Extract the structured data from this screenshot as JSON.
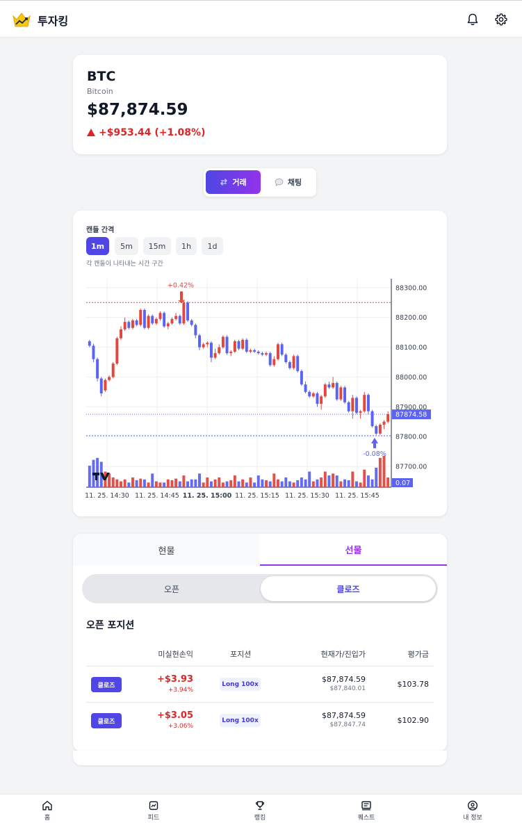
{
  "app": {
    "title": "투자킹"
  },
  "icons": {
    "logo": "crown-chart-icon",
    "notifications": "bell-icon",
    "settings": "gear-icon"
  },
  "ticker": {
    "symbol": "BTC",
    "name": "Bitcoin",
    "price": "$87,874.59",
    "change": "+$953.44 (+1.08%)",
    "direction": "up"
  },
  "mode_tabs": [
    {
      "label": "거래",
      "icon": "exchange-icon",
      "active": true
    },
    {
      "label": "채팅",
      "icon": "chat-bubble-icon",
      "active": false
    }
  ],
  "interval": {
    "label": "캔들 간격",
    "options": [
      "1m",
      "5m",
      "15m",
      "1h",
      "1d"
    ],
    "selected": "1m",
    "hint": "각 캔들이 나타내는 시간 구간"
  },
  "chart_data": {
    "type": "candlestick",
    "y_ticks": [
      "88300.00",
      "88200.00",
      "88100.00",
      "88000.00",
      "87900.00",
      "87800.00",
      "87700.00"
    ],
    "ylim": [
      87630,
      88330
    ],
    "x_ticks": [
      "11. 25. 14:30",
      "11. 25. 14:45",
      "11. 25. 15:00",
      "11. 25. 15:15",
      "11. 25. 15:30",
      "11. 25. 15:45"
    ],
    "x_tick_bold_index": 2,
    "current_price_label": "87874.58",
    "current_price": 87874.58,
    "volume_label": "0.07",
    "high_marker": {
      "label": "+0.42%",
      "value": 88250
    },
    "low_marker": {
      "label": "-0.08%",
      "value": 87803
    },
    "candles": [
      [
        88120,
        88105,
        88125,
        88100
      ],
      [
        88105,
        88060,
        88112,
        88050
      ],
      [
        88060,
        87995,
        88065,
        87985
      ],
      [
        87995,
        87945,
        88000,
        87935
      ],
      [
        87955,
        87990,
        87995,
        87950
      ],
      [
        87990,
        88000,
        88005,
        87985
      ],
      [
        88000,
        88045,
        88050,
        87995
      ],
      [
        88045,
        88130,
        88135,
        88040
      ],
      [
        88130,
        88160,
        88170,
        88125
      ],
      [
        88160,
        88185,
        88200,
        88155
      ],
      [
        88185,
        88165,
        88190,
        88160
      ],
      [
        88165,
        88190,
        88195,
        88160
      ],
      [
        88190,
        88175,
        88195,
        88170
      ],
      [
        88175,
        88225,
        88230,
        88170
      ],
      [
        88225,
        88165,
        88230,
        88160
      ],
      [
        88165,
        88205,
        88210,
        88160
      ],
      [
        88205,
        88180,
        88210,
        88175
      ],
      [
        88180,
        88195,
        88200,
        88175
      ],
      [
        88195,
        88215,
        88220,
        88190
      ],
      [
        88215,
        88170,
        88220,
        88165
      ],
      [
        88170,
        88180,
        88185,
        88160
      ],
      [
        88180,
        88195,
        88200,
        88175
      ],
      [
        88195,
        88205,
        88215,
        88190
      ],
      [
        88205,
        88180,
        88210,
        88175
      ],
      [
        88180,
        88250,
        88260,
        88175
      ],
      [
        88250,
        88190,
        88255,
        88185
      ],
      [
        88190,
        88175,
        88195,
        88170
      ],
      [
        88175,
        88140,
        88180,
        88130
      ],
      [
        88140,
        88100,
        88145,
        88090
      ],
      [
        88100,
        88110,
        88115,
        88095
      ],
      [
        88110,
        88115,
        88120,
        88100
      ],
      [
        88115,
        88065,
        88120,
        88050
      ],
      [
        88065,
        88080,
        88095,
        88060
      ],
      [
        88080,
        88100,
        88110,
        88075
      ],
      [
        88100,
        88135,
        88140,
        88095
      ],
      [
        88135,
        88080,
        88140,
        88075
      ],
      [
        88080,
        88085,
        88090,
        88070
      ],
      [
        88085,
        88120,
        88125,
        88080
      ],
      [
        88120,
        88095,
        88125,
        88090
      ],
      [
        88095,
        88125,
        88130,
        88090
      ],
      [
        88125,
        88085,
        88130,
        88080
      ],
      [
        88085,
        88090,
        88095,
        88080
      ],
      [
        88090,
        88085,
        88095,
        88080
      ],
      [
        88085,
        88080,
        88090,
        88075
      ],
      [
        88080,
        88075,
        88085,
        88070
      ],
      [
        88075,
        88080,
        88085,
        88070
      ],
      [
        88080,
        88040,
        88085,
        88035
      ],
      [
        88040,
        88060,
        88070,
        88035
      ],
      [
        88060,
        88110,
        88115,
        88055
      ],
      [
        88110,
        88075,
        88115,
        88070
      ],
      [
        88075,
        88050,
        88080,
        88045
      ],
      [
        88050,
        88030,
        88055,
        88025
      ],
      [
        88030,
        88070,
        88075,
        88025
      ],
      [
        88070,
        88020,
        88075,
        88015
      ],
      [
        88020,
        87975,
        88025,
        87970
      ],
      [
        87975,
        87950,
        87985,
        87945
      ],
      [
        87950,
        87935,
        87955,
        87930
      ],
      [
        87935,
        87945,
        87950,
        87930
      ],
      [
        87945,
        87910,
        87950,
        87900
      ],
      [
        87910,
        87935,
        87940,
        87890
      ],
      [
        87935,
        87975,
        87980,
        87930
      ],
      [
        87975,
        87965,
        87985,
        87960
      ],
      [
        87965,
        87980,
        88000,
        87960
      ],
      [
        87980,
        87925,
        87985,
        87920
      ],
      [
        87925,
        87965,
        87970,
        87920
      ],
      [
        87965,
        87915,
        87970,
        87910
      ],
      [
        87915,
        87885,
        87920,
        87880
      ],
      [
        87885,
        87930,
        87940,
        87860
      ],
      [
        87930,
        87880,
        87935,
        87875
      ],
      [
        87880,
        87885,
        87890,
        87860
      ],
      [
        87885,
        87940,
        87950,
        87880
      ],
      [
        87940,
        87885,
        87945,
        87875
      ],
      [
        87885,
        87835,
        87890,
        87830
      ],
      [
        87835,
        87810,
        87840,
        87805
      ],
      [
        87810,
        87840,
        87845,
        87805
      ],
      [
        87840,
        87850,
        87855,
        87825
      ],
      [
        87850,
        87875,
        87885,
        87845
      ]
    ],
    "volumes": [
      0.055,
      0.07,
      0.075,
      0.065,
      0.04,
      0.035,
      0.025,
      0.02,
      0.015,
      0.02,
      0.012,
      0.025,
      0.018,
      0.022,
      0.02,
      0.012,
      0.035,
      0.015,
      0.012,
      0.012,
      0.02,
      0.018,
      0.022,
      0.015,
      0.03,
      0.015,
      0.02,
      0.02,
      0.035,
      0.012,
      0.025,
      0.015,
      0.02,
      0.025,
      0.012,
      0.015,
      0.018,
      0.03,
      0.015,
      0.02,
      0.012,
      0.025,
      0.012,
      0.03,
      0.02,
      0.018,
      0.015,
      0.035,
      0.02,
      0.015,
      0.025,
      0.015,
      0.012,
      0.018,
      0.025,
      0.02,
      0.04,
      0.015,
      0.02,
      0.025,
      0.04,
      0.03,
      0.035,
      0.03,
      0.015,
      0.02,
      0.018,
      0.04,
      0.015,
      0.012,
      0.045,
      0.03,
      0.02,
      0.05,
      0.075,
      0.08,
      0.025
    ]
  },
  "trade": {
    "tabs": [
      {
        "label": "현물",
        "active": false
      },
      {
        "label": "선물",
        "active": true
      }
    ],
    "toggle": {
      "open_label": "오픈",
      "close_label": "클로즈",
      "selected": "close"
    },
    "section_title": "오픈 포지션",
    "columns": [
      "미실현손익",
      "포지션",
      "현재가/진입가",
      "평가금"
    ],
    "positions": [
      {
        "action": "클로즈",
        "pnl": "+$3.93",
        "pnl_pct": "+3.94%",
        "position": "Long 100x",
        "current": "$87,874.59",
        "entry": "$87,840.01",
        "value": "$103.78"
      },
      {
        "action": "클로즈",
        "pnl": "+$3.05",
        "pnl_pct": "+3.06%",
        "position": "Long 100x",
        "current": "$87,874.59",
        "entry": "$87,847.74",
        "value": "$102.90"
      }
    ]
  },
  "bottom_nav": [
    {
      "label": "홈",
      "icon": "home-icon"
    },
    {
      "label": "피드",
      "icon": "feed-icon"
    },
    {
      "label": "랭킹",
      "icon": "trophy-icon"
    },
    {
      "label": "퀘스트",
      "icon": "quest-board-icon"
    },
    {
      "label": "내 정보",
      "icon": "profile-icon"
    }
  ],
  "colors": {
    "accent": "#4f46e5",
    "accent_purple": "#9333ea",
    "up": "#dc2626",
    "down": "#5b63f0",
    "candle_up": "#e0473f",
    "candle_down": "#5b63f0"
  }
}
